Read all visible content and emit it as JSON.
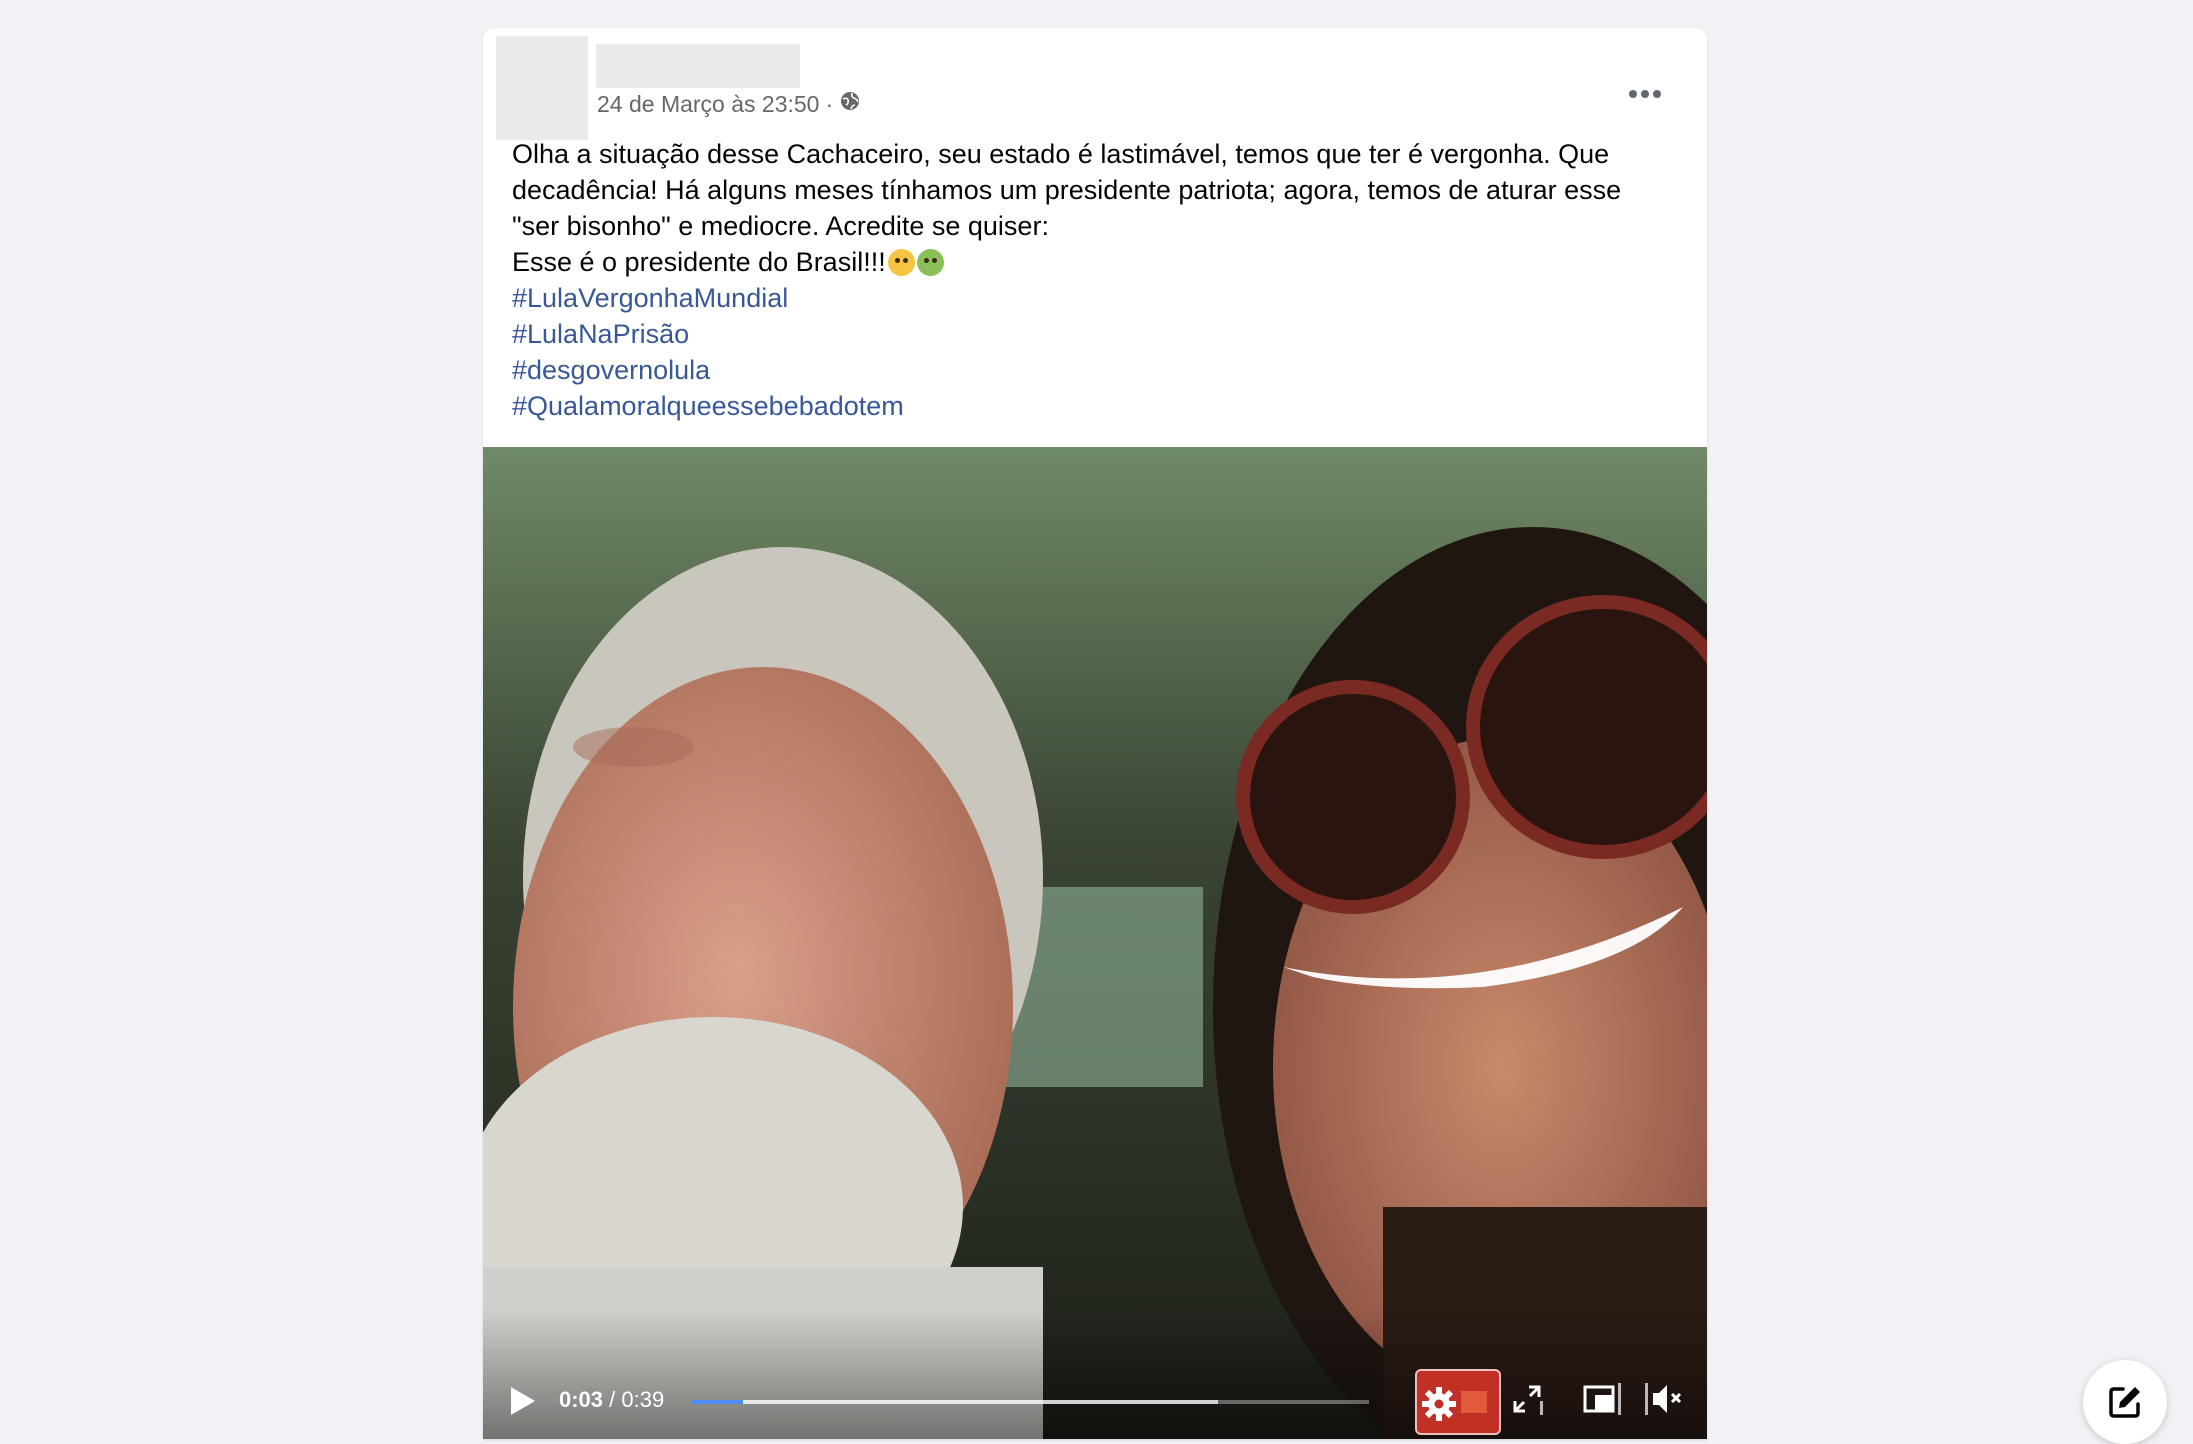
{
  "post": {
    "timestamp": "24 de Março às 23:50",
    "separator": "·",
    "privacy_icon": "globe-icon",
    "more_icon": "ellipsis-icon",
    "text_lines": [
      "Olha a situação desse Cachaceiro, seu estado é lastimável, temos que ter é vergonha. Que",
      "decadência!  Há alguns meses tínhamos um presidente patriota; agora, temos de aturar esse",
      "\"ser bisonho\" e mediocre.  Acredite se quiser:",
      "Esse é o presidente do Brasil!!!"
    ],
    "emojis": [
      "flushed-face-emoji",
      "nauseated-face-emoji"
    ],
    "hashtags": [
      "#LulaVergonhaMundial",
      "#LulaNaPrisão",
      "#desgovernolula",
      "#Qualamoralqueessebebadotem"
    ]
  },
  "video": {
    "current_time": "0:03",
    "time_separator": "/",
    "duration": "0:39",
    "progress_fraction": 0.077,
    "buffered_fraction": 0.778,
    "progress_color": "#4e8df6",
    "controls": [
      "play-icon",
      "settings-icon",
      "fullscreen-icon",
      "picture-in-picture-icon",
      "mute-icon"
    ]
  },
  "fab": {
    "icon": "compose-icon"
  },
  "colors": {
    "background": "#f0f2f5",
    "link": "#385898",
    "meta_text": "#65676b"
  }
}
